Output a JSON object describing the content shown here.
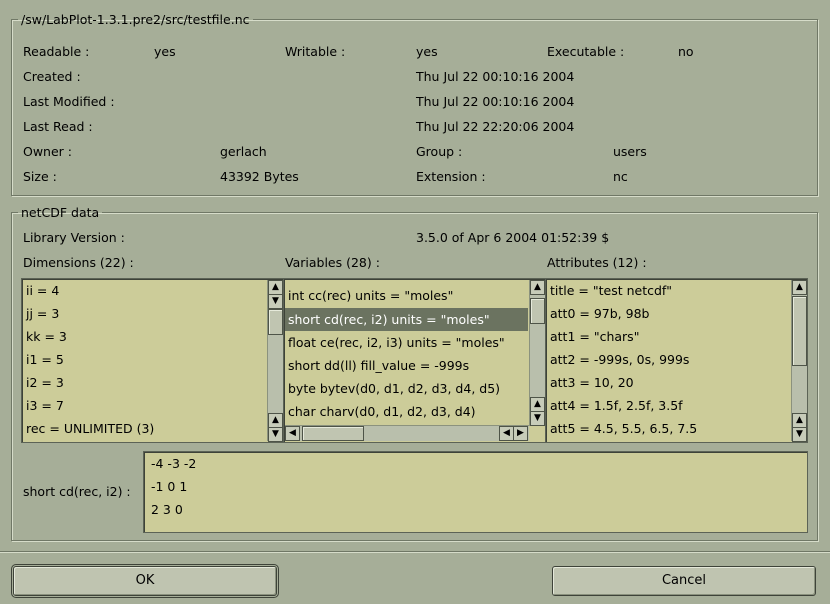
{
  "file_group": {
    "title": "/sw/LabPlot-1.3.1.pre2/src/testfile.nc",
    "readable_label": "Readable :",
    "readable_value": "yes",
    "writable_label": "Writable :",
    "writable_value": "yes",
    "executable_label": "Executable :",
    "executable_value": "no",
    "created_label": "Created :",
    "created_value": "Thu Jul 22 00:10:16 2004",
    "modified_label": "Last Modified :",
    "modified_value": "Thu Jul 22 00:10:16 2004",
    "read_label": "Last Read :",
    "read_value": "Thu Jul 22 22:20:06 2004",
    "owner_label": "Owner :",
    "owner_value": "gerlach",
    "group_label": "Group :",
    "group_value": "users",
    "size_label": "Size :",
    "size_value": "43392 Bytes",
    "extension_label": "Extension :",
    "extension_value": "nc"
  },
  "netcdf_group": {
    "title": "netCDF data",
    "library_label": "Library Version :",
    "library_value": "3.5.0 of Apr  6 2004 01:52:39 $",
    "dimensions_label": "Dimensions (22) :",
    "variables_label": "Variables (28) :",
    "attributes_label": "Attributes (12) :",
    "dimensions": [
      "ii = 4",
      "jj = 3",
      "kk = 3",
      "i1 = 5",
      "i2 = 3",
      "i3 = 7",
      "rec = UNLIMITED (3)"
    ],
    "variables": [
      "int cc(rec)    units = \"moles\"",
      "short cd(rec, i2)    units = \"moles\"",
      "float ce(rec, i2, i3)    units = \"moles\"",
      "short dd(ll)    fill_value = -999s",
      "byte bytev(d0, d1, d2, d3, d4, d5)",
      "char charv(d0, d1, d2, d3, d4)"
    ],
    "attributes": [
      "title = \"test netcdf\"",
      "att0 = 97b, 98b",
      "att1 = \"chars\"",
      "att2 = -999s, 0s, 999s",
      "att3 = 10, 20",
      "att4 = 1.5f, 2.5f, 3.5f",
      "att5 = 4.5, 5.5, 6.5, 7.5"
    ],
    "selected_variable_label": "short cd(rec, i2)  :",
    "data_lines": [
      "-4 -3 -2",
      "-1 0 1",
      "2 3 0"
    ]
  },
  "buttons": {
    "ok": "OK",
    "cancel": "Cancel"
  },
  "icons": {
    "up": "▲",
    "down": "▼",
    "top": "⇑",
    "bottom": "⇓",
    "left": "◀",
    "right": "▶"
  },
  "colors": {
    "list_bg": "#cccc99",
    "selection_bg": "#6b7360",
    "window_bg": "#a6ae98"
  }
}
